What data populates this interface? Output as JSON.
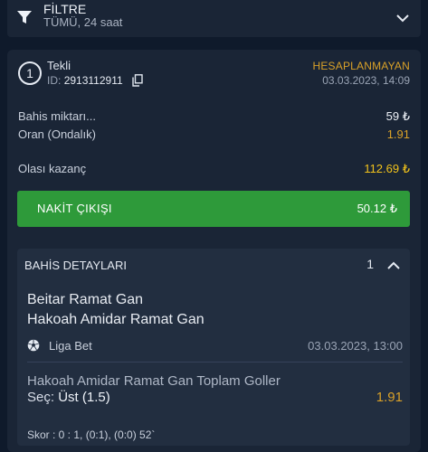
{
  "filter": {
    "title": "FİLTRE",
    "subtitle": "TÜMÜ, 24 saat"
  },
  "bet": {
    "number": "1",
    "type": "Tekli",
    "id_label": "ID:",
    "id_value": "2913112911",
    "status": "HESAPLANMAYAN",
    "datetime": "03.03.2023, 14:09",
    "stake_label": "Bahis miktarı...",
    "stake_value": "59 ₺",
    "odds_label": "Oran (Ondalık)",
    "odds_value": "1.91",
    "potential_label": "Olası kazanç",
    "potential_value": "112.69 ₺"
  },
  "cashout": {
    "label": "NAKİT ÇIKIŞI",
    "value": "50.12 ₺"
  },
  "details": {
    "title": "BAHİS DETAYLARI",
    "count": "1",
    "home_team": "Beitar Ramat Gan",
    "away_team": "Hakoah Amidar Ramat Gan",
    "league": "Liga Bet",
    "match_datetime": "03.03.2023, 13:00",
    "market": "Hakoah Amidar Ramat Gan Toplam Goller",
    "selection_label": "Seç:",
    "selection_value": "Üst (1.5)",
    "selection_odds": "1.91",
    "score": "Skor : 0 : 1, (0:1), (0:0) 52`"
  },
  "colors": {
    "background": "#0f1a2b",
    "card": "#1a2536",
    "accent_green": "#2e9a3a",
    "accent_orange": "#d9a128",
    "accent_yellow": "#f1c21b"
  },
  "icons": [
    "filter-icon",
    "chevron-down-icon",
    "copy-icon",
    "chevron-up-icon",
    "soccer-ball-icon"
  ]
}
